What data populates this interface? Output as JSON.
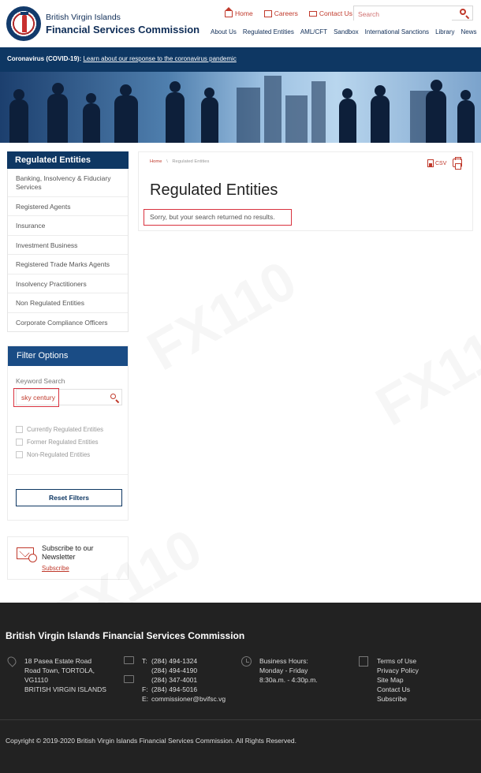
{
  "header": {
    "logo_line1": "British Virgin Islands",
    "logo_line2": "Financial Services Commission",
    "util_nav": [
      "Home",
      "Careers",
      "Contact Us"
    ],
    "search_placeholder": "Search",
    "main_nav": [
      "About Us",
      "Regulated Entities",
      "AML/CFT",
      "Sandbox",
      "International Sanctions",
      "Library",
      "News"
    ]
  },
  "covid_bar": {
    "label": "Coronavirus (COVID-19):",
    "link": "Learn about our response to the coronavirus pandemic"
  },
  "sidebar": {
    "header": "Regulated Entities",
    "items": [
      "Banking, Insolvency & Fiduciary Services",
      "Registered Agents",
      "Insurance",
      "Investment Business",
      "Registered Trade Marks Agents",
      "Insolvency Practitioners",
      "Non Regulated Entities",
      "Corporate Compliance Officers"
    ]
  },
  "filter": {
    "header": "Filter Options",
    "keyword_label": "Keyword Search",
    "keyword_value": "sky century",
    "checkboxes": [
      "Currently Regulated Entities",
      "Former Regulated Entities",
      "Non-Regulated Entities"
    ],
    "reset_label": "Reset Filters"
  },
  "newsletter": {
    "title": "Subscribe to our Newsletter",
    "link": "Subscribe"
  },
  "content": {
    "breadcrumb_home": "Home",
    "breadcrumb_sep": "\\",
    "breadcrumb_current": "Regulated Entities",
    "csv_label": "CSV",
    "title": "Regulated Entities",
    "no_results": "Sorry, but your search returned no results."
  },
  "footer": {
    "title": "British Virgin Islands Financial Services Commission",
    "address": [
      "18 Pasea Estate Road",
      "Road Town, TORTOLA,",
      "VG1110",
      "BRITISH VIRGIN ISLANDS"
    ],
    "contact_labels": [
      "T:",
      "",
      "",
      "F:",
      "E:"
    ],
    "contact_values": [
      "(284) 494-1324",
      "(284) 494-4190",
      "(284) 347-4001",
      "(284) 494-5016",
      "commissioner@bvifsc.vg"
    ],
    "hours": [
      "Business Hours:",
      "Monday - Friday",
      "8:30a.m. - 4:30p.m."
    ],
    "links": [
      "Terms of Use",
      "Privacy Policy",
      "Site Map",
      "Contact Us",
      "Subscribe"
    ],
    "copyright": "Copyright © 2019-2020 British Virgin Islands Financial Services Commission. All Rights Reserved."
  },
  "watermark": "FX110",
  "colors": {
    "navy": "#0e3763",
    "accent_red": "#c0392b",
    "footer_bg": "#222222"
  }
}
